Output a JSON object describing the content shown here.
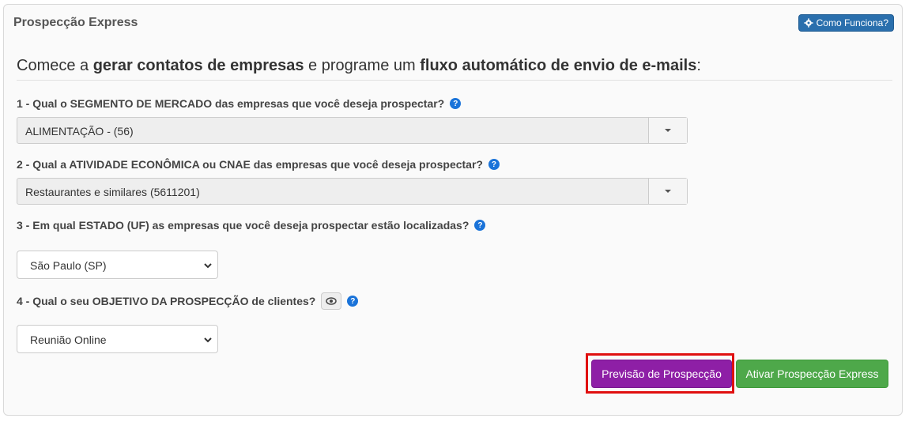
{
  "panel": {
    "title": "Prospecção Express",
    "help_button": "Como Funciona?"
  },
  "intro": {
    "part1": "Comece a ",
    "bold1": "gerar contatos de empresas",
    "part2": " e programe um ",
    "bold2": "fluxo automático de envio de e-mails",
    "part3": ":"
  },
  "questions": {
    "q1": {
      "label": "1 - Qual o SEGMENTO DE MERCADO das empresas que você deseja prospectar?",
      "value": "ALIMENTAÇÃO - (56)"
    },
    "q2": {
      "label": "2 - Qual a ATIVIDADE ECONÔMICA ou CNAE das empresas que você deseja prospectar?",
      "value": "Restaurantes e similares (5611201)"
    },
    "q3": {
      "label": "3 - Em qual ESTADO (UF) as empresas que você deseja prospectar estão localizadas?",
      "value": "São Paulo (SP)"
    },
    "q4": {
      "label": "4 - Qual o seu OBJETIVO DA PROSPECÇÃO de clientes?",
      "value": "Reunião Online"
    }
  },
  "actions": {
    "preview": "Previsão de Prospecção",
    "activate": "Ativar Prospecção Express"
  },
  "colors": {
    "preview_bg": "#8e1fa6",
    "activate_bg": "#4ea84a",
    "help_bg": "#2a6fad",
    "highlight": "#e01010"
  },
  "icons": {
    "help_button_icon": "gear-icon",
    "question_help": "question-circle-icon",
    "objective_preview": "eye-icon"
  }
}
